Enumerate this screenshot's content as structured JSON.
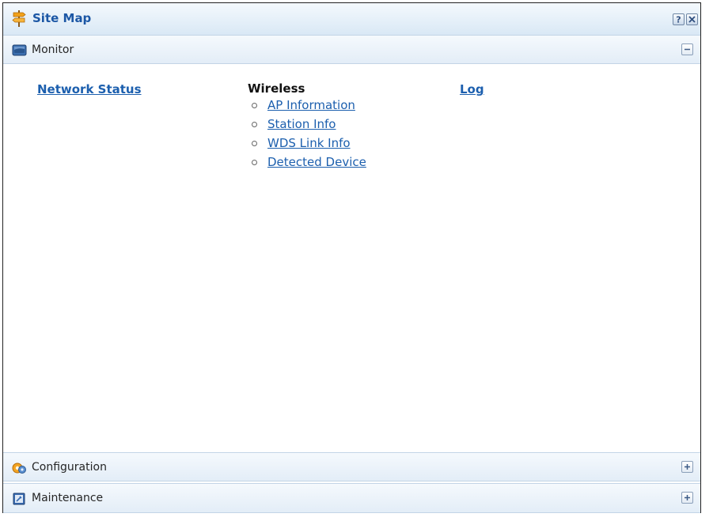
{
  "window": {
    "title": "Site Map",
    "help_icon": "question-icon",
    "close_icon": "close-icon"
  },
  "sections": {
    "monitor": {
      "label": "Monitor",
      "icon": "monitor-icon",
      "toggle": "collapse"
    },
    "configuration": {
      "label": "Configuration",
      "icon": "configuration-icon",
      "toggle": "expand"
    },
    "maintenance": {
      "label": "Maintenance",
      "icon": "maintenance-icon",
      "toggle": "expand"
    }
  },
  "monitor_content": {
    "network_status": "Network Status",
    "wireless": {
      "heading": "Wireless",
      "items": [
        "AP Information",
        "Station Info",
        "WDS Link Info",
        "Detected Device"
      ]
    },
    "log": "Log"
  },
  "colors": {
    "link": "#1c5fae",
    "title": "#1c57a5",
    "header_bg": "#e3edf7"
  }
}
